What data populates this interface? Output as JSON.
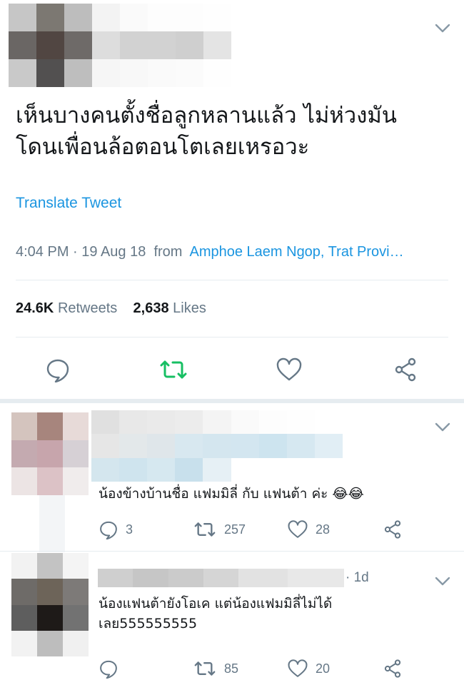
{
  "tweet": {
    "text_line1": "เห็นบางคนตั้งชื่อลูกหลานแล้ว ไม่ห่วงมัน",
    "text_line2": "โดนเพื่อนล้อตอนโตเลยเหรอวะ",
    "translate": "Translate Tweet",
    "time": "4:04 PM · 19 Aug 18",
    "from_label": "from",
    "location": "Amphoe Laem Ngop, Trat Provi…",
    "retweets_count": "24.6K",
    "retweets_label": "Retweets",
    "likes_count": "2,638",
    "likes_label": "Likes"
  },
  "replies": [
    {
      "text": "น้องข้างบ้านชื่อ แฟมมิลี่ กับ แฟนต้า ค่ะ 😂😂",
      "reply_count": "3",
      "retweet_count": "257",
      "like_count": "28"
    },
    {
      "time": "· 1d",
      "text_line1": "น้องแฟนต้ายังโอเค แต่น้องแฟมมิลี่ไม่ได้",
      "text_line2": "เลย555555555",
      "reply_count": "",
      "retweet_count": "85",
      "like_count": "20"
    }
  ],
  "colors": {
    "link": "#1b95e0",
    "retweet_active": "#17bf63",
    "muted": "#657786",
    "divider": "#e6ecf0"
  },
  "icons": [
    "chevron-down-icon",
    "reply-icon",
    "retweet-icon",
    "like-icon",
    "share-icon"
  ]
}
